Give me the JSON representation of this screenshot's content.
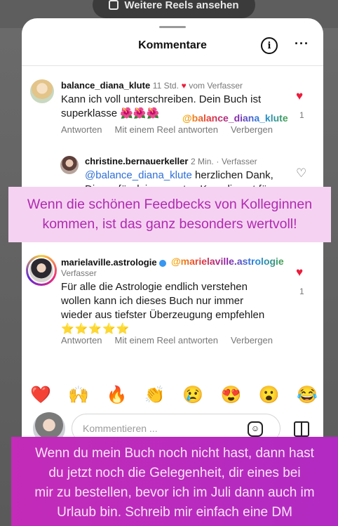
{
  "top": {
    "reels_button": "Weitere Reels ansehen"
  },
  "sheet": {
    "title": "Kommentare"
  },
  "comments": [
    {
      "user": "balance_diana_klute",
      "time": "11 Std.",
      "badge": "vom Verfasser",
      "text": "Kann ich voll unterschreiben. Dein Buch ist superklasse",
      "emojis": "🌺🌺🌺",
      "sticker": "@balance_diana_klute",
      "likes": "1",
      "actions": [
        "Antworten",
        "Mit einem Reel antworten",
        "Verbergen"
      ]
    },
    {
      "user": "christine.bernauerkeller",
      "time": "2 Min.",
      "badge": "Verfasser",
      "mention": "@balance_diana_klute",
      "text": "herzlichen Dank,",
      "text2": "Diana, für dein erneutes Kompliment für"
    },
    {
      "user": "marielaville.astrologie",
      "sticker": "@marielaville.astrologie",
      "badge": "Verfasser",
      "text_lines": [
        "Für alle die Astrologie endlich verstehen",
        "wollen kann ich dieses Buch nur immer",
        "wieder aus tiefster Überzeugung empfehlen"
      ],
      "stars": "⭐⭐⭐⭐⭐",
      "likes": "1",
      "actions": [
        "Antworten",
        "Mit einem Reel antworten",
        "Verbergen"
      ]
    }
  ],
  "emoji_bar": [
    "❤️",
    "🙌",
    "🔥",
    "👏",
    "😢",
    "😍",
    "😮",
    "😂"
  ],
  "compose": {
    "placeholder": "Kommentieren ..."
  },
  "overlay": {
    "pink": [
      "Wenn die schönen Feedbecks von Kolleginnen",
      "kommen, ist das ganz besonders wertvoll!"
    ],
    "purple": [
      "Wenn du mein Buch noch nicht hast, dann hast",
      "du jetzt noch die Gelegenheit, dir eines bei",
      "mir zu bestellen, bevor ich im Juli dann auch im",
      "Urlaub bin. Schreib mir einfach eine DM"
    ]
  },
  "colors": {
    "heart": "#ed1c3b",
    "mention": "#2f6fd8",
    "pink_banner": "#f5d2f2",
    "purple_banner": "#c32bb8"
  }
}
